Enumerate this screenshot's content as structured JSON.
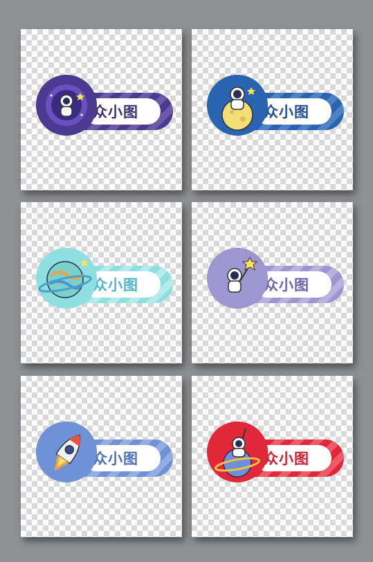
{
  "badges": [
    {
      "label": "众小图",
      "accent": "#4b3a8f",
      "stripe": "#6b5aa8",
      "text_color": "#3b2f7a",
      "icon": "astronaut-galaxy-icon"
    },
    {
      "label": "众小图",
      "accent": "#2a63b0",
      "stripe": "#4d82c7",
      "text_color": "#1f4f96",
      "icon": "astronaut-moon-icon"
    },
    {
      "label": "众小图",
      "accent": "#8fdfe0",
      "stripe": "#b4ecec",
      "text_color": "#4fb4cf",
      "icon": "planet-icon"
    },
    {
      "label": "众小图",
      "accent": "#9e96d0",
      "stripe": "#b8b2de",
      "text_color": "#6d63b0",
      "icon": "astronaut-star-icon"
    },
    {
      "label": "众小图",
      "accent": "#6f92d6",
      "stripe": "#93aee3",
      "text_color": "#4c6fc0",
      "icon": "rocket-icon"
    },
    {
      "label": "众小图",
      "accent": "#e0283a",
      "stripe": "#ee5a66",
      "text_color": "#d11f30",
      "icon": "astronaut-planet-icon"
    }
  ]
}
